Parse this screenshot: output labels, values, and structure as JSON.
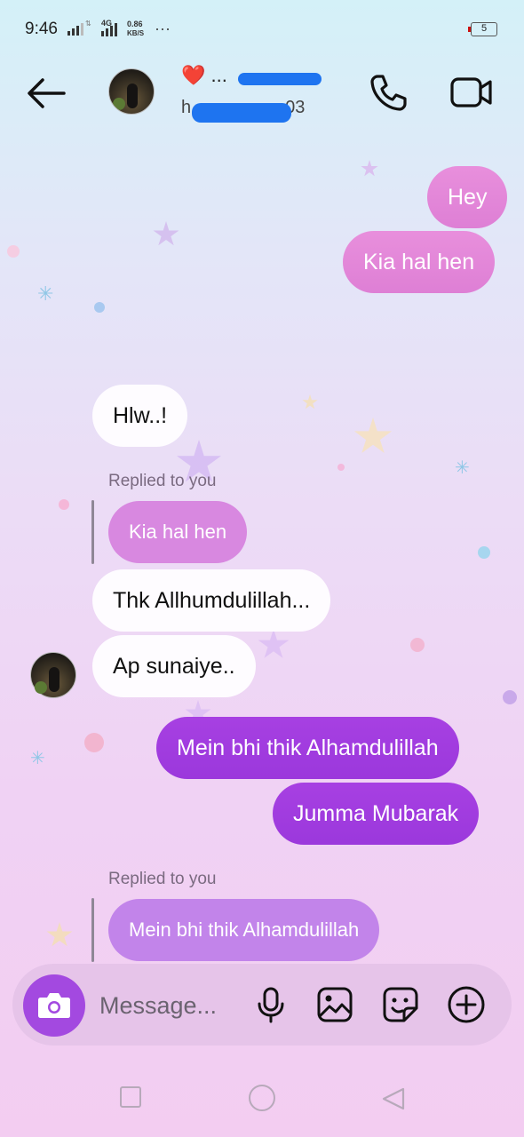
{
  "status_bar": {
    "time": "9:46",
    "network_type": "4G",
    "data_speed_value": "0.86",
    "data_speed_unit": "KB/S",
    "more_indicator": "···",
    "battery_level": "5"
  },
  "header": {
    "name_prefix": "❤️ ...",
    "username_visible": "h",
    "username_suffix": "03",
    "back_icon": "back-arrow-icon",
    "call_icon": "phone-icon",
    "video_icon": "video-camera-icon"
  },
  "messages": {
    "out_1": "Hey",
    "out_2": "Kia hal hen",
    "in_1": "Hlw..!",
    "reply_1_label": "Replied to you",
    "reply_1_quote": "Kia hal hen",
    "in_2": "Thk Allhumdulillah...",
    "in_3": "Ap sunaiye..",
    "out_3": "Mein bhi thik Alhamdulillah",
    "out_4": "Jumma Mubarak",
    "reply_2_label": "Replied to you",
    "reply_2_quote": "Mein bhi thik Alhamdulillah"
  },
  "composer": {
    "placeholder": "Message...",
    "camera_icon": "camera-icon",
    "mic_icon": "microphone-icon",
    "gallery_icon": "gallery-icon",
    "sticker_icon": "sticker-icon",
    "add_icon": "plus-circle-icon"
  },
  "nav_bar": {
    "recent_icon": "square-icon",
    "home_icon": "circle-icon",
    "back_icon": "triangle-back-icon"
  },
  "colors": {
    "outgoing_pink": "#e88fdc",
    "outgoing_purple": "#a740e2",
    "incoming_white": "#fefcff",
    "accent": "#a349e0"
  }
}
